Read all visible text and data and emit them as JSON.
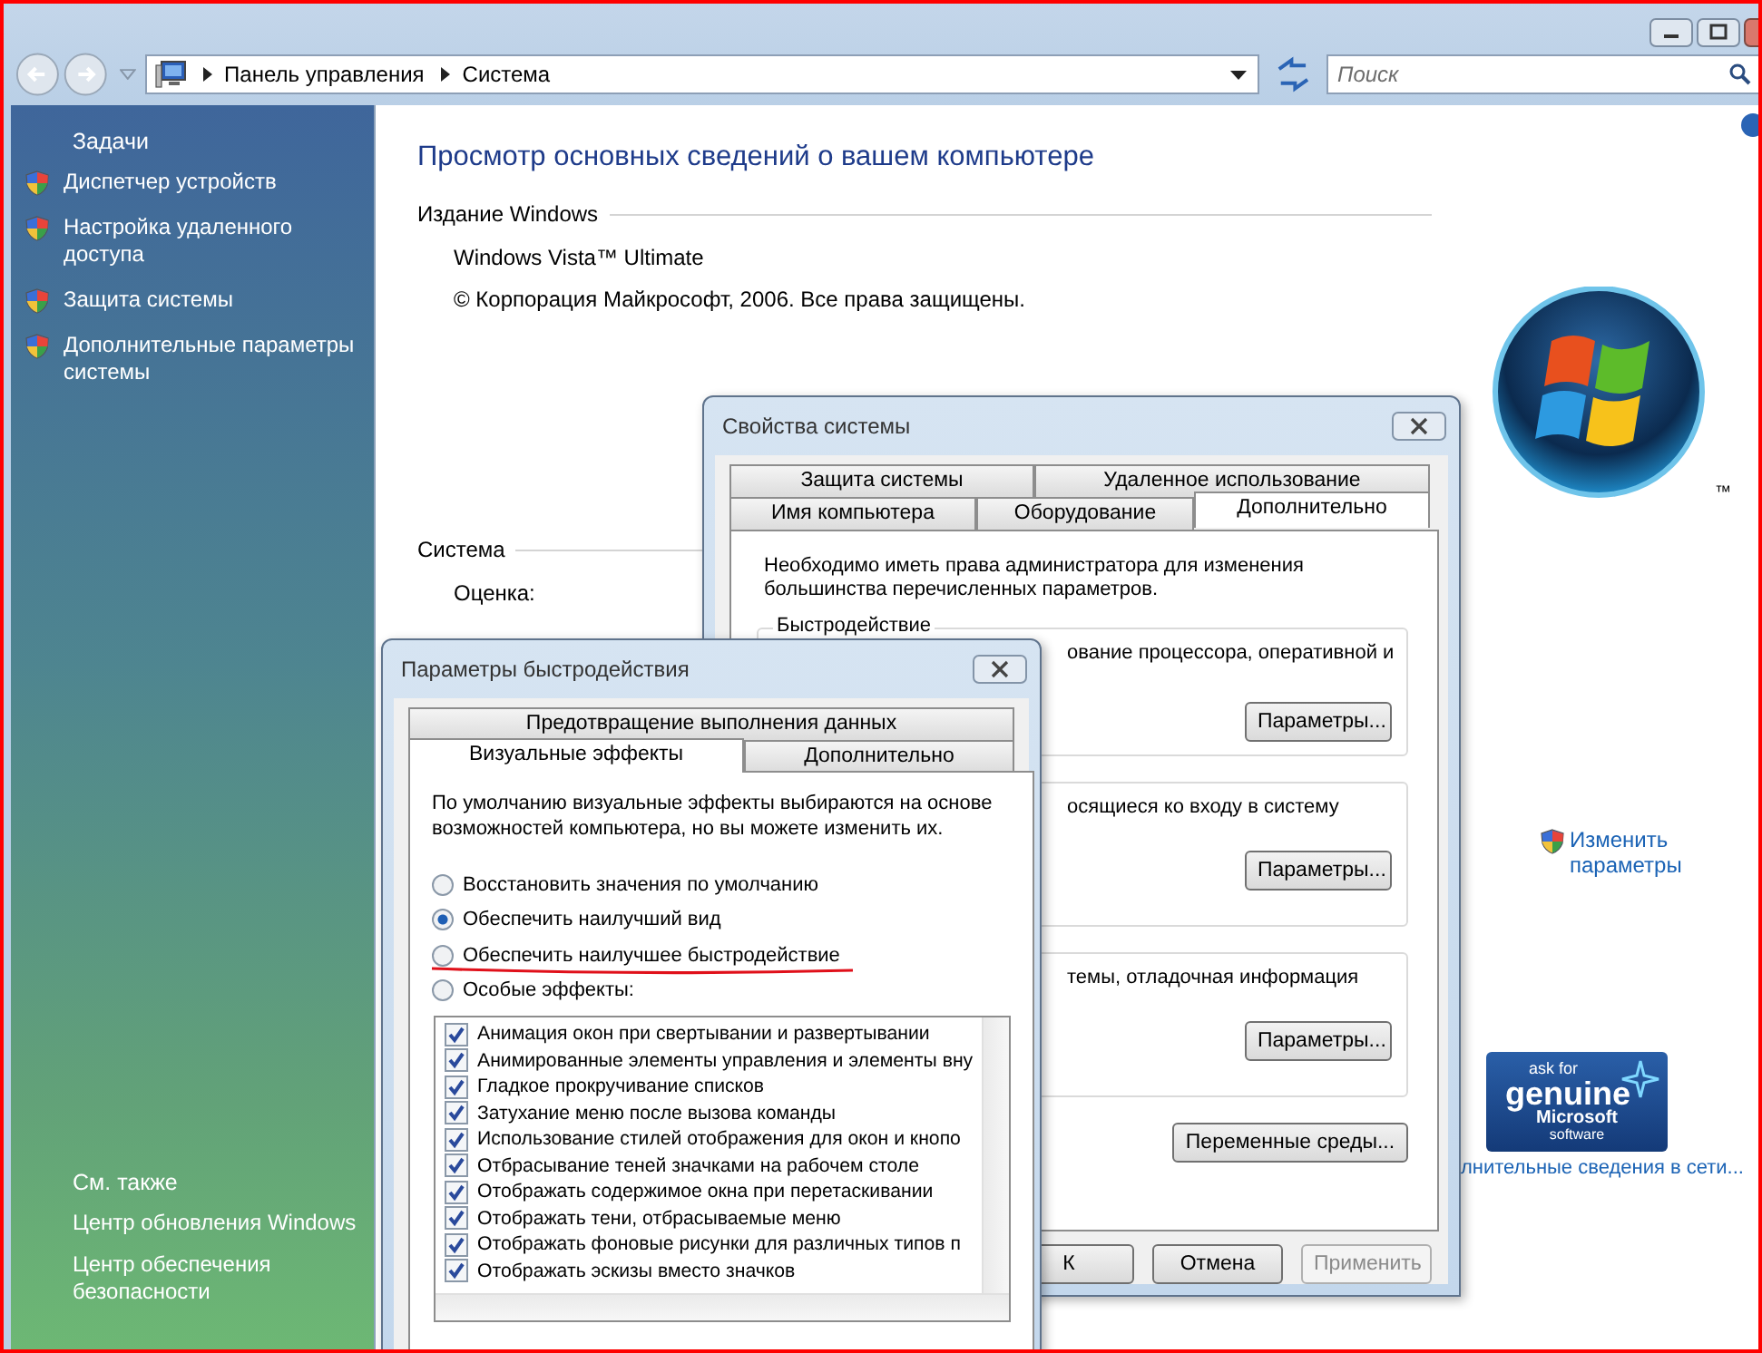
{
  "address_bar": {
    "breadcrumbs": [
      "Панель управления",
      "Система"
    ]
  },
  "search": {
    "placeholder": "Поиск"
  },
  "sidebar": {
    "tasks_heading": "Задачи",
    "tasks": [
      {
        "label": "Диспетчер устройств"
      },
      {
        "label": "Настройка удаленного доступа"
      },
      {
        "label": "Защита системы"
      },
      {
        "label": "Дополнительные параметры системы"
      }
    ],
    "see_also_heading": "См. также",
    "see_also": [
      {
        "label": "Центр обновления Windows"
      },
      {
        "label": "Центр обеспечения безопасности"
      }
    ]
  },
  "main": {
    "heading": "Просмотр основных сведений о вашем компьютере",
    "sections": [
      {
        "title": "Издание Windows",
        "lines": [
          "Windows Vista™ Ultimate",
          "© Корпорация Майкрософт, 2006. Все права защищены."
        ]
      },
      {
        "title": "Система",
        "lines": [
          "Оценка:"
        ]
      }
    ],
    "logo_mark": "™",
    "change_settings_link": "Изменить параметры",
    "genuine_badge": [
      "ask for",
      "genuine",
      "Microsoft",
      "software"
    ],
    "online_link": "лнительные сведения в сети..."
  },
  "system_properties": {
    "title": "Свойства системы",
    "tab_rows": [
      [
        {
          "label": "Защита системы",
          "selected": false
        },
        {
          "label": "Удаленное использование",
          "selected": false
        }
      ],
      [
        {
          "label": "Имя компьютера",
          "selected": false
        },
        {
          "label": "Оборудование",
          "selected": false
        },
        {
          "label": "Дополнительно",
          "selected": true
        }
      ]
    ],
    "notice": "Необходимо иметь права администратора для изменения большинства перечисленных параметров.",
    "groups": [
      {
        "label": "Быстродействие",
        "text": "ование процессора, оперативной и",
        "button": "Параметры..."
      },
      {
        "text": "осящиеся ко входу в систему",
        "button": "Параметры..."
      },
      {
        "text": "темы, отладочная информация",
        "button": "Параметры..."
      }
    ],
    "env_button": "Переменные среды...",
    "buttons": [
      {
        "label": "К",
        "disabled": false
      },
      {
        "label": "Отмена",
        "disabled": false
      },
      {
        "label": "Применить",
        "disabled": true
      }
    ]
  },
  "performance_options": {
    "title": "Параметры быстродействия",
    "tab_rows": [
      [
        {
          "label": "Предотвращение выполнения данных",
          "selected": false
        }
      ],
      [
        {
          "label": "Визуальные эффекты",
          "selected": true
        },
        {
          "label": "Дополнительно",
          "selected": false
        }
      ]
    ],
    "description": "По умолчанию визуальные эффекты выбираются на основе возможностей компьютера, но вы можете изменить их.",
    "options": [
      {
        "label": "Восстановить значения по умолчанию",
        "selected": false
      },
      {
        "label": "Обеспечить наилучший вид",
        "selected": true
      },
      {
        "label": "Обеспечить наилучшее быстродействие",
        "selected": false,
        "underlined": true
      },
      {
        "label": "Особые эффекты:",
        "selected": false
      }
    ],
    "effects": [
      {
        "label": "Анимация окон при свертывании и развертывании",
        "checked": true
      },
      {
        "label": "Анимированные элементы управления и элементы вну",
        "checked": true
      },
      {
        "label": "Гладкое прокручивание списков",
        "checked": true
      },
      {
        "label": "Затухание меню после вызова команды",
        "checked": true
      },
      {
        "label": "Использование стилей отображения для окон и кнопо",
        "checked": true
      },
      {
        "label": "Отбрасывание теней значками на рабочем столе",
        "checked": true
      },
      {
        "label": "Отображать содержимое окна при перетаскивании",
        "checked": true
      },
      {
        "label": "Отображать тени, отбрасываемые меню",
        "checked": true
      },
      {
        "label": "Отображать фоновые рисунки для различных типов п",
        "checked": true
      },
      {
        "label": "Отображать эскизы вместо значков",
        "checked": true
      }
    ]
  }
}
